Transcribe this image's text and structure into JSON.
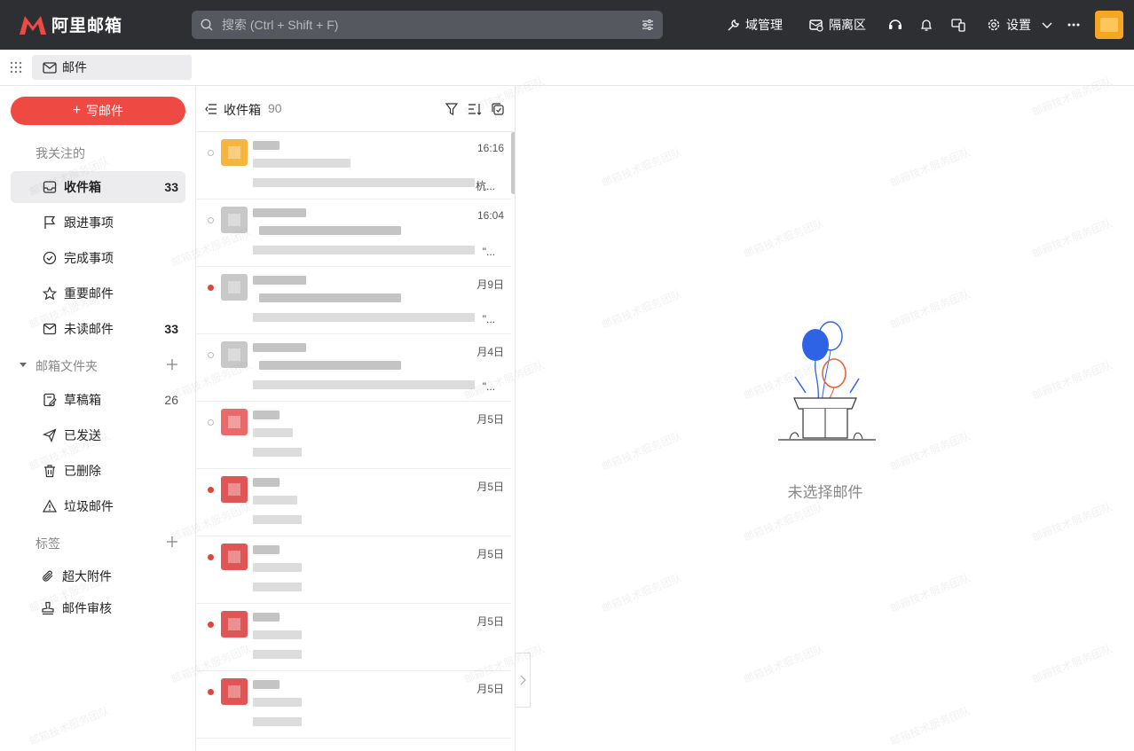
{
  "app": {
    "title": "阿里邮箱",
    "brand_color": "#ee4a43"
  },
  "search": {
    "placeholder": "搜索 (Ctrl + Shift + F)"
  },
  "topbar": {
    "domain_admin": "域管理",
    "quarantine": "隔离区",
    "settings": "设置"
  },
  "subbar": {
    "tab_label": "邮件"
  },
  "sidebar": {
    "compose_label": "写邮件",
    "favorites_title": "我关注的",
    "favorites": [
      {
        "label": "收件箱",
        "count": "33",
        "icon": "inbox-icon"
      },
      {
        "label": "跟进事项",
        "count": "",
        "icon": "flag-icon"
      },
      {
        "label": "完成事项",
        "count": "",
        "icon": "check-circle-icon"
      },
      {
        "label": "重要邮件",
        "count": "",
        "icon": "star-icon"
      },
      {
        "label": "未读邮件",
        "count": "33",
        "icon": "envelope-icon"
      }
    ],
    "folders_title": "邮箱文件夹",
    "folders": [
      {
        "label": "草稿箱",
        "count": "26",
        "icon": "draft-icon"
      },
      {
        "label": "已发送",
        "count": "",
        "icon": "send-icon"
      },
      {
        "label": "已删除",
        "count": "",
        "icon": "trash-icon"
      },
      {
        "label": "垃圾邮件",
        "count": "",
        "icon": "warning-icon"
      }
    ],
    "tags_title": "标签",
    "extras": [
      {
        "label": "超大附件",
        "icon": "paperclip-icon"
      },
      {
        "label": "邮件审核",
        "icon": "stamp-icon"
      }
    ]
  },
  "mail_list": {
    "title": "收件箱",
    "count": "90",
    "rows": [
      {
        "time": "16:16",
        "unread": false,
        "avatar_color": "#f5b53f",
        "snippet": "杭..."
      },
      {
        "time": "16:04",
        "unread": false,
        "avatar_color": "#c8c8c8",
        "snippet": "\"..."
      },
      {
        "time": "月9日",
        "unread": true,
        "avatar_color": "#c8c8c8",
        "snippet": "\"..."
      },
      {
        "time": "月4日",
        "unread": false,
        "avatar_color": "#c8c8c8",
        "snippet": "\"..."
      },
      {
        "time": "月5日",
        "unread": false,
        "avatar_color": "#e86a6a",
        "snippet": ""
      },
      {
        "time": "月5日",
        "unread": true,
        "avatar_color": "#e05555",
        "snippet": ""
      },
      {
        "time": "月5日",
        "unread": true,
        "avatar_color": "#e05555",
        "snippet": ""
      },
      {
        "time": "月5日",
        "unread": true,
        "avatar_color": "#e05555",
        "snippet": ""
      },
      {
        "time": "月5日",
        "unread": true,
        "avatar_color": "#e05555",
        "snippet": ""
      }
    ]
  },
  "reading_pane": {
    "empty_text": "未选择邮件"
  },
  "watermark": "邮箱技术服务团队"
}
